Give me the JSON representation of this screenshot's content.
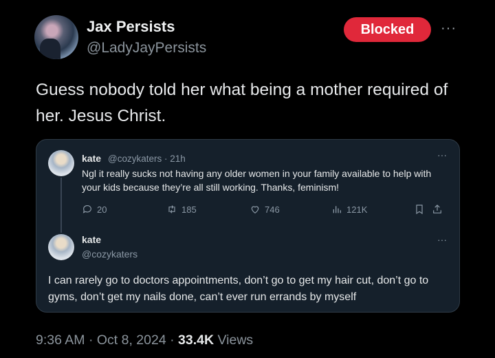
{
  "author": {
    "display_name": "Jax Persists",
    "handle": "@LadyJayPersists",
    "blocked_label": "Blocked",
    "more_label": "···"
  },
  "tweet": {
    "text": "Guess nobody told her what being a mother required of her. Jesus Christ."
  },
  "quoted": {
    "name": "kate",
    "handle_time": "@cozykaters · 21h",
    "more_label": "···",
    "text": "Ngl it really sucks not having any older women in your family available to help with your kids because they’re all still working. Thanks, feminism!",
    "stats": {
      "replies": "20",
      "retweets": "185",
      "likes": "746",
      "views": "121K"
    },
    "reply": {
      "name": "kate",
      "handle": "@cozykaters",
      "more_label": "···",
      "text": "I can rarely go to doctors appointments, don’t go to get my hair cut, don’t go to gyms, don’t get my nails done, can’t ever run errands by myself"
    }
  },
  "meta": {
    "time_date": "9:36 AM · Oct 8, 2024 · ",
    "views_count": "33.4K",
    "views_label": " Views"
  },
  "icons": [
    "reply-icon",
    "retweet-icon",
    "like-icon",
    "views-icon",
    "bookmark-icon",
    "share-icon"
  ],
  "colors": {
    "blocked": "#e0283a",
    "card_bg": "#15202b",
    "muted": "#8b98a5"
  }
}
